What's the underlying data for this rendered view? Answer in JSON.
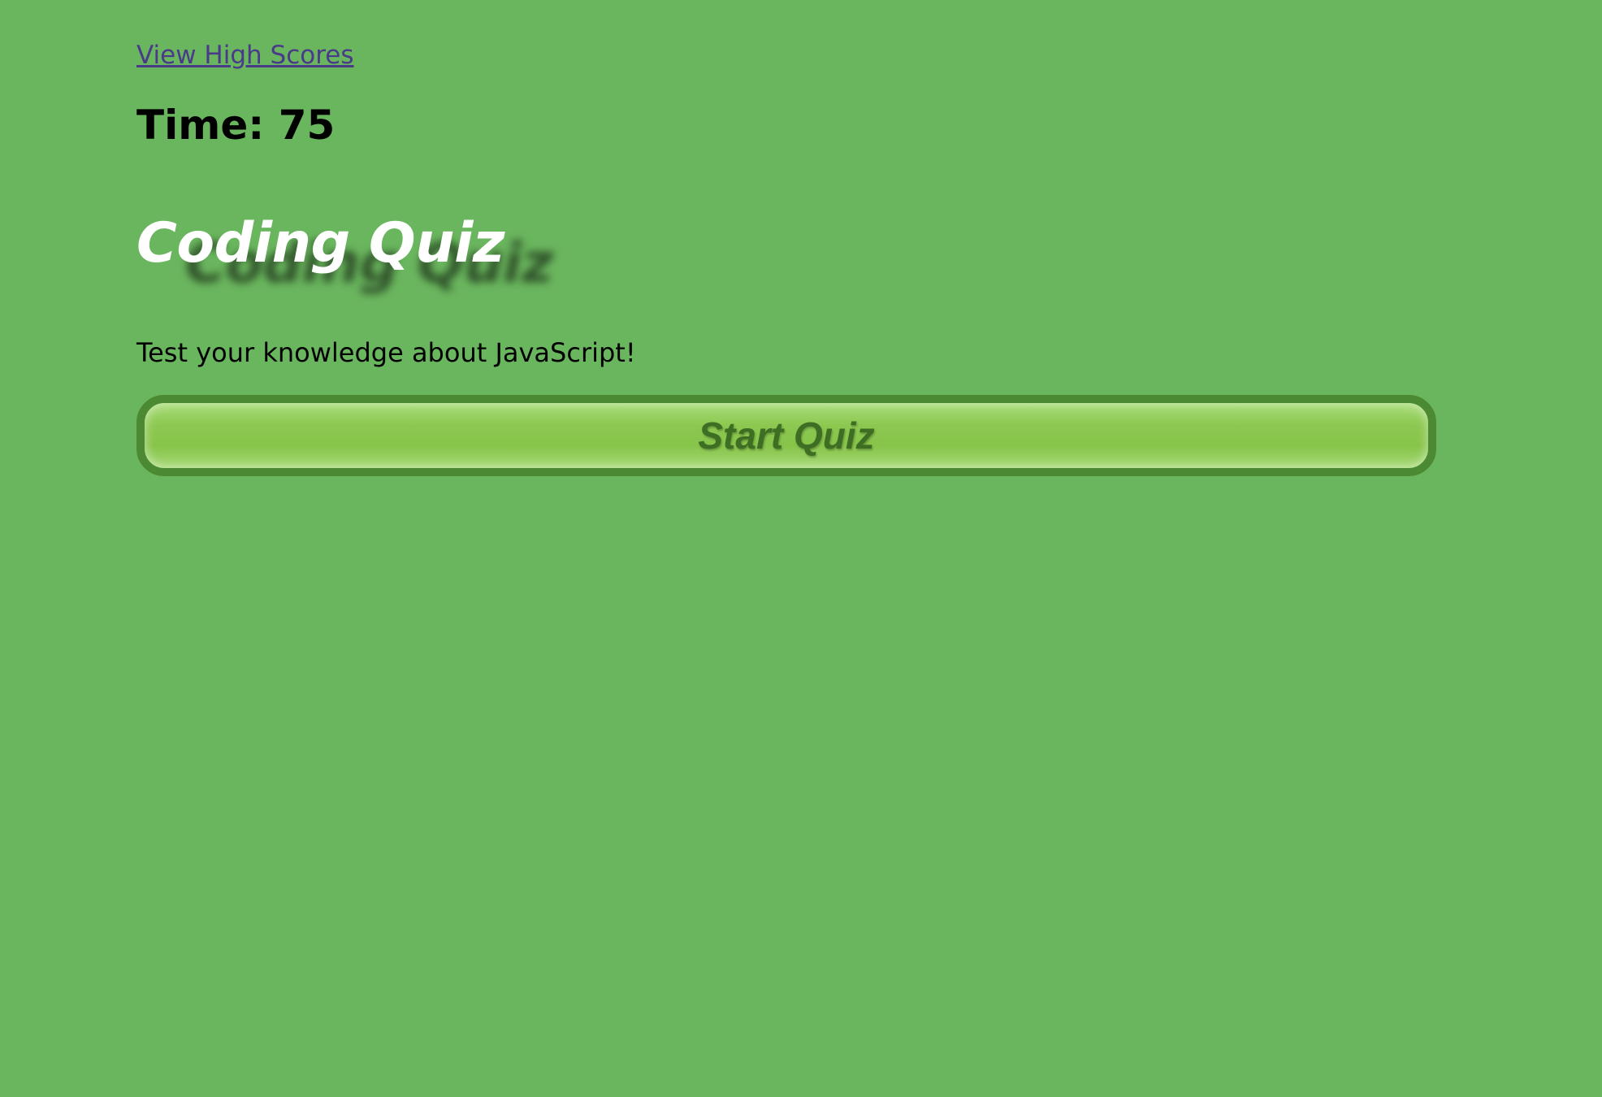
{
  "nav": {
    "high_scores_link": "View High Scores"
  },
  "timer": {
    "label": "Time:",
    "value": "75"
  },
  "quiz": {
    "title": "Coding Quiz",
    "subtitle": "Test your knowledge about JavaScript!",
    "start_button_label": "Start Quiz"
  },
  "colors": {
    "background": "#6ab65e",
    "link": "#4a3a8a",
    "title": "#ffffff",
    "button_border": "#4b8a32",
    "button_fill": "#8cc850",
    "button_text": "#3e6d24"
  }
}
